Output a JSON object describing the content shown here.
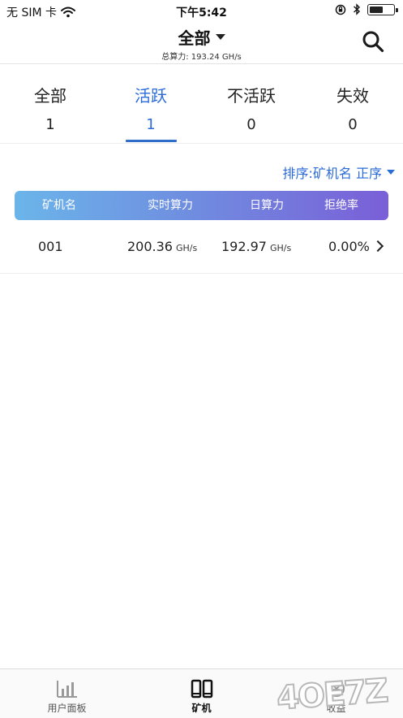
{
  "status_bar": {
    "carrier": "无 SIM 卡",
    "time": "下午5:42",
    "icons": [
      "wifi-icon",
      "rotation-lock-icon",
      "bluetooth-icon",
      "battery-icon"
    ]
  },
  "nav": {
    "title": "全部",
    "subtitle": "总算力: 193.24 GH/s",
    "search_icon": "search-icon"
  },
  "tabs": [
    {
      "label": "全部",
      "count": "1"
    },
    {
      "label": "活跃",
      "count": "1"
    },
    {
      "label": "不活跃",
      "count": "0"
    },
    {
      "label": "失效",
      "count": "0"
    }
  ],
  "active_tab": 1,
  "sort": {
    "label": "排序:矿机名 正序"
  },
  "table": {
    "headers": [
      "矿机名",
      "实时算力",
      "日算力",
      "拒绝率"
    ],
    "rows": [
      {
        "name": "001",
        "realtime": "200.36",
        "realtime_unit": "GH/s",
        "daily": "192.97",
        "daily_unit": "GH/s",
        "reject": "0.00%"
      }
    ]
  },
  "tabbar": {
    "items": [
      {
        "label": "用户面板",
        "icon": "bar-chart-icon"
      },
      {
        "label": "矿机",
        "icon": "miner-icon"
      },
      {
        "label": "收益",
        "icon": "earnings-icon"
      }
    ],
    "active": 1
  },
  "watermark": {
    "text": "4OE7Z"
  },
  "colors": {
    "accent": "#2a6bd8",
    "header_gradient_start": "#6bb5ea",
    "header_gradient_end": "#7a5fd8"
  }
}
